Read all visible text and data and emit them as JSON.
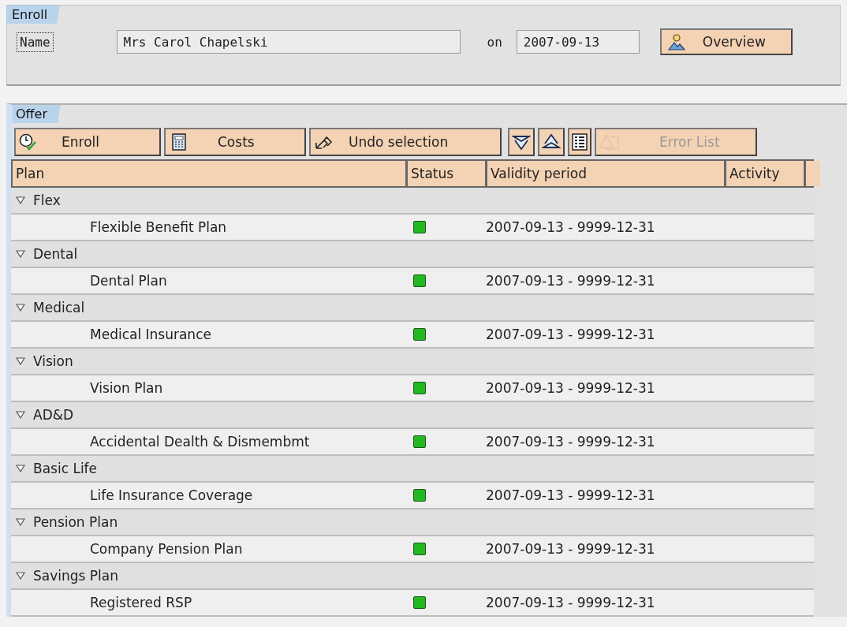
{
  "enroll_panel": {
    "title": "Enroll",
    "name_label": "Name",
    "name_value": "Mrs Carol Chapelski",
    "date_label": "on",
    "date_value": "2007-09-13",
    "overview_button": "Overview"
  },
  "offer_panel": {
    "title": "Offer",
    "toolbar": [
      {
        "kind": "enroll",
        "label": "Enroll",
        "disabled": false
      },
      {
        "kind": "costs",
        "label": "Costs",
        "disabled": false
      },
      {
        "kind": "undo",
        "label": "Undo selection",
        "disabled": false
      },
      {
        "kind": "expand",
        "disabled": false
      },
      {
        "kind": "collapse",
        "disabled": false
      },
      {
        "kind": "details",
        "disabled": false
      },
      {
        "kind": "errors",
        "label": "Error List",
        "disabled": true
      }
    ],
    "table": {
      "columns": [
        "Plan",
        "Status",
        "Validity period",
        "Activity"
      ],
      "rows": [
        {
          "label": "Flex",
          "expanded": true,
          "children": [
            {
              "label": "Flexible Benefit Plan",
              "color": "#22b822",
              "validity": "2007-09-13 - 9999-12-31"
            }
          ]
        },
        {
          "label": "Dental",
          "expanded": true,
          "children": [
            {
              "label": "Dental Plan",
              "color": "#22b822",
              "validity": "2007-09-13 - 9999-12-31"
            }
          ]
        },
        {
          "label": "Medical",
          "expanded": true,
          "children": [
            {
              "label": "Medical Insurance",
              "color": "#22b822",
              "validity": "2007-09-13 - 9999-12-31"
            }
          ]
        },
        {
          "label": "Vision",
          "expanded": true,
          "children": [
            {
              "label": "Vision Plan",
              "color": "#22b822",
              "validity": "2007-09-13 - 9999-12-31"
            }
          ]
        },
        {
          "label": "AD&D",
          "expanded": true,
          "children": [
            {
              "label": "Accidental Dealth & Dismembmt",
              "color": "#22b822",
              "validity": "2007-09-13 - 9999-12-31"
            }
          ]
        },
        {
          "label": "Basic Life",
          "expanded": true,
          "children": [
            {
              "label": "Life Insurance Coverage",
              "color": "#22b822",
              "validity": "2007-09-13 - 9999-12-31"
            }
          ]
        },
        {
          "label": "Pension Plan",
          "expanded": true,
          "children": [
            {
              "label": "Company Pension Plan",
              "color": "#22b822",
              "validity": "2007-09-13 - 9999-12-31"
            }
          ]
        },
        {
          "label": "Savings Plan",
          "expanded": true,
          "children": [
            {
              "label": "Registered RSP",
              "color": "#22b822",
              "validity": "2007-09-13 - 9999-12-31"
            }
          ]
        }
      ]
    }
  }
}
